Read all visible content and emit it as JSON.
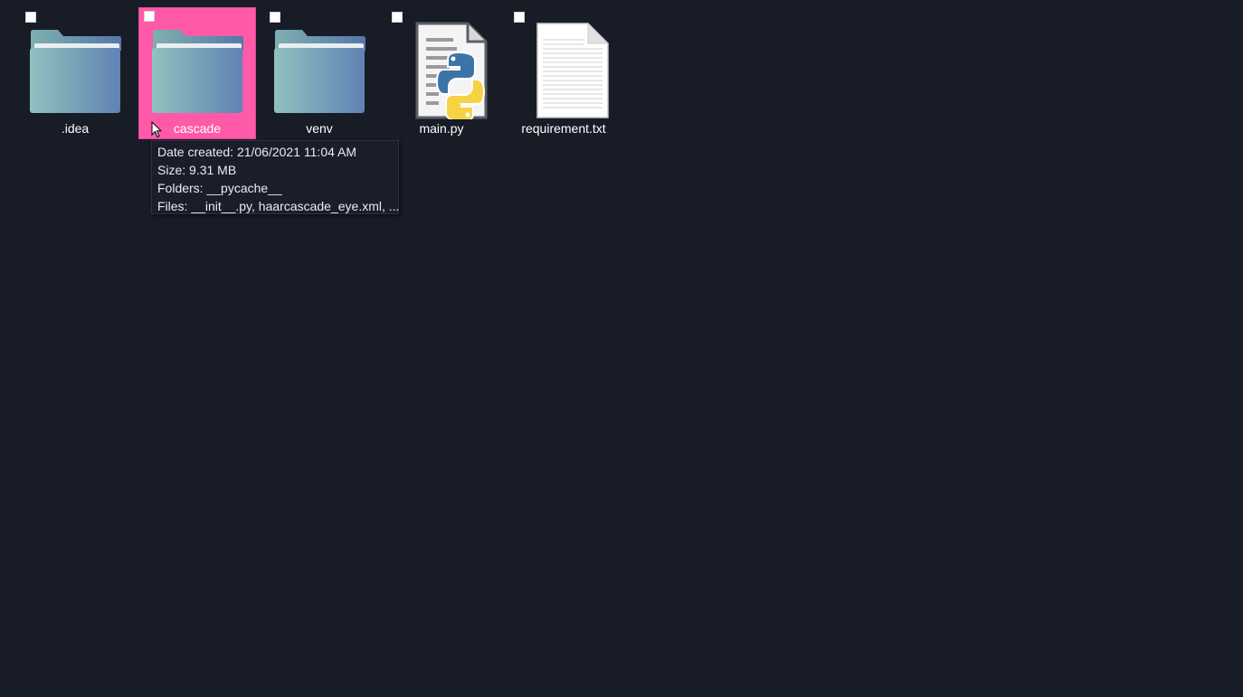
{
  "desktop": {
    "items": [
      {
        "label": ".idea",
        "icon": "folder-icon"
      },
      {
        "label": "cascade",
        "icon": "folder-icon",
        "selected": true
      },
      {
        "label": "venv",
        "icon": "folder-icon"
      },
      {
        "label": "main.py",
        "icon": "python-file-icon"
      },
      {
        "label": "requirement.txt",
        "icon": "text-file-icon"
      }
    ]
  },
  "tooltip": {
    "date_created": "Date created: 21/06/2021 11:04 AM",
    "size": "Size: 9.31 MB",
    "folders": "Folders: __pycache__",
    "files": "Files: __init__.py, haarcascade_eye.xml, ..."
  },
  "colors": {
    "background": "#181c27",
    "selection": "#ff5aa8",
    "folder_gradient_start": "#8fbfbd",
    "folder_gradient_end": "#6184b3",
    "python_blue": "#3b73a6",
    "python_yellow": "#f7d344"
  }
}
